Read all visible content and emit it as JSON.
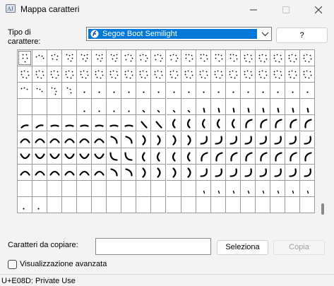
{
  "window": {
    "title": "Mappa caratteri"
  },
  "font": {
    "label": "Tipo di carattere:",
    "selected": "Segoe Boot Semilight"
  },
  "help_button": "?",
  "grid": {
    "columns": 20,
    "rows": 10,
    "selected_index": 0,
    "glyphs": [
      "dots1",
      "dots2",
      "dots3",
      "dots4",
      "dots4",
      "dots4",
      "dots4",
      "dots5",
      "dots5",
      "dots5",
      "dots5",
      "dots6",
      "dots6",
      "dots6",
      "dots6",
      "dots7",
      "dots7",
      "dots7",
      "dots7",
      "dots7",
      "dots7",
      "dots7",
      "dots7",
      "dots7",
      "dots7",
      "dots7",
      "dots7",
      "dots7",
      "dots7",
      "dots7",
      "dots7",
      "dots7",
      "dots7",
      "dots7",
      "dots7",
      "dots7",
      "dots7",
      "dots7",
      "dots7",
      "dots7",
      "dots8",
      "dots9",
      "dots10",
      "dots11",
      "dot",
      "dot",
      "dot",
      "dot",
      "dot",
      "dot",
      "dot",
      "dot",
      "dot",
      "dot",
      "dot",
      "dot",
      "dot",
      "dot",
      "dot",
      "dot",
      "",
      "",
      "",
      "",
      "dot-b",
      "dot-b",
      "dot-b",
      "dot-b",
      "dash-b",
      "dash-b",
      "dash-b",
      "dash-b",
      "tick",
      "tick",
      "tick",
      "tick",
      "tick",
      "tick",
      "tick",
      "tick",
      "arc-bl",
      "arc-bl",
      "arc-b",
      "arc-b",
      "arc-b",
      "arc-b",
      "arc-b",
      "arc-b",
      "arc-tl",
      "arc-tl",
      "arc-l",
      "arc-l",
      "arc-l",
      "arc-l",
      "arc-l",
      "arc-lt",
      "arc-lt",
      "arc-lt",
      "arc-lt",
      "arc-lt",
      "arc-top",
      "arc-top",
      "arc-top",
      "arc-top",
      "arc-top",
      "arc-top",
      "arc-tr",
      "arc-tr",
      "arc-r",
      "arc-r",
      "arc-r",
      "arc-r",
      "arc-rb",
      "arc-rb",
      "arc-rb",
      "arc-rb",
      "arc-rb",
      "arc-rb",
      "arc-rb",
      "arc-rb",
      "cup",
      "cup",
      "cup",
      "cup",
      "cup",
      "cup",
      "arc-lb",
      "arc-lb",
      "arc-l",
      "arc-l",
      "arc-l",
      "arc-l",
      "arc-lt",
      "arc-lt",
      "arc-lt",
      "arc-lt",
      "arc-lt",
      "arc-lt",
      "arc-lt",
      "arc-lt",
      "arc-top",
      "arc-top",
      "arc-top",
      "arc-top",
      "arc-top",
      "arc-top",
      "arc-tr",
      "arc-tr",
      "arc-r",
      "arc-r",
      "arc-r",
      "arc-r",
      "arc-rb",
      "arc-rb",
      "arc-rb",
      "arc-rb",
      "arc-rb",
      "arc-rb",
      "arc-rb",
      "arc-rb",
      "",
      "",
      "",
      "",
      "",
      "",
      "",
      "",
      "",
      "",
      "",
      "",
      "tick-s",
      "tick-s",
      "tick-s",
      "tick-s",
      "tick-s",
      "tick-s",
      "tick-s",
      "tick-s",
      "dot-sm",
      "dot-sm",
      "",
      "",
      "",
      "",
      "",
      "",
      "",
      "",
      "",
      "",
      "",
      "",
      "",
      "",
      "",
      "",
      "",
      ""
    ]
  },
  "copy": {
    "label": "Caratteri da copiare:",
    "value": "",
    "select_button": "Seleziona",
    "copy_button": "Copia"
  },
  "advanced": {
    "label": "Visualizzazione avanzata",
    "checked": false
  },
  "status": {
    "text": "U+E08D: Private Use"
  },
  "colors": {
    "selection": "#0078d7",
    "grid_line": "#9a9a9a",
    "disabled_text": "#9d9d9d"
  }
}
